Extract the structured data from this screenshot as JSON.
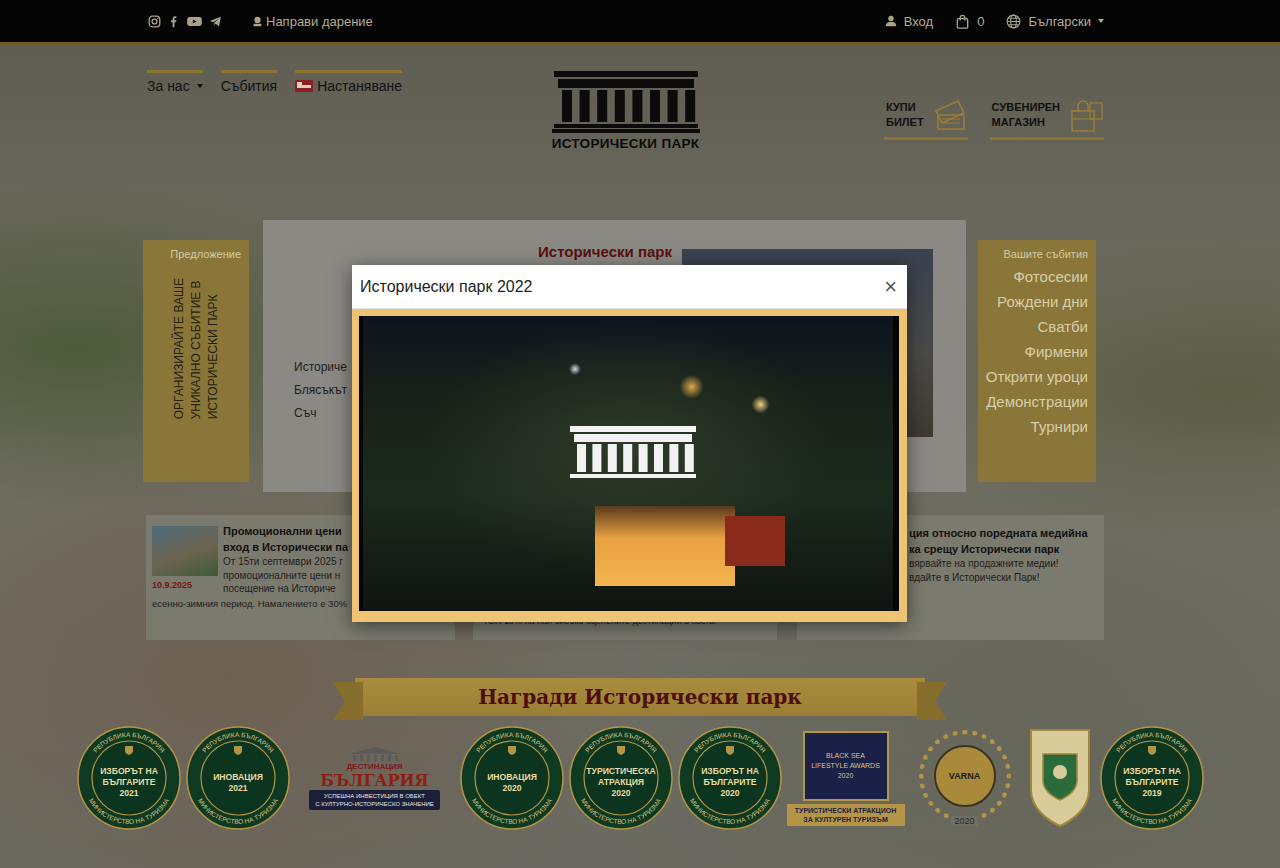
{
  "topbar": {
    "donate": "Направи дарение",
    "login": "Вход",
    "cart_count": "0",
    "language": {
      "label": "Български",
      "dropdown": true
    }
  },
  "nav": [
    {
      "label": "За нас",
      "dropdown": true
    },
    {
      "label": "Събития",
      "dropdown": false
    },
    {
      "label": "Настаняване",
      "dropdown": false
    }
  ],
  "logo": "ИСТОРИЧЕСКИ ПАРК",
  "actions": [
    {
      "lines": [
        "КУПИ",
        "БИЛЕТ"
      ]
    },
    {
      "lines": [
        "СУВЕНИРЕН",
        "МАГАЗИН"
      ]
    }
  ],
  "offer": {
    "label": "Предложение",
    "lines": [
      "ОРГАНИЗИРАЙТЕ ВАШЕ",
      "УНИКАЛНО СЪБИТИЕ В",
      "ИСТОРИЧЕСКИ ПАРК"
    ]
  },
  "feature": {
    "title": "Исторически парк",
    "lines": [
      "Историче",
      "Блясъкът",
      "Съч"
    ]
  },
  "events": {
    "label": "Вашите събития",
    "items": [
      "Фотосесии",
      "Рождени дни",
      "Сватби",
      "Фирмени",
      "Открити уроци",
      "Демонстрации",
      "Турнири"
    ]
  },
  "news_left": {
    "title_lines": [
      "Промоционални цени",
      "вход в Исторически па"
    ],
    "date": "10.9.2025",
    "body_lines": [
      "От 15ти септември 2025 г",
      "промоционалните цени н",
      "посещение на Историче"
    ],
    "tail": "есенно-зимния период. Намалението е 30%"
  },
  "news_middle": {
    "body_lines": [
      "ТОП 10% на най-високо оценените дестинации в света."
    ]
  },
  "news_right": {
    "title_lines": [
      "ция относно поредната медийна",
      "ка срещу Исторически парк"
    ],
    "body_lines": [
      "вярвайте на продажните медии!",
      "вдайте в Исторически Парк!"
    ]
  },
  "awards": {
    "title": "Награди Исторически парк",
    "badges": [
      {
        "kind": "green",
        "top": "РЕПУБЛИКА БЪЛГАРИЯ",
        "lines": [
          "ИЗБОРЪТ НА",
          "БЪЛГАРИТЕ",
          "2021"
        ],
        "bottom": "МИНИСТЕРСТВО НА ТУРИЗМА"
      },
      {
        "kind": "green",
        "top": "РЕПУБЛИКА БЪЛГАРИЯ",
        "lines": [
          "ИНОВАЦИЯ",
          "2021"
        ],
        "bottom": "МИНИСТЕРСТВО НА ТУРИЗМА"
      },
      {
        "kind": "destination",
        "lines": [
          "ДЕСТИНАЦИЯ",
          "БЪЛГАРИЯ"
        ],
        "ribbon": [
          "УСПЕШНА ИНВЕСТИЦИЯ В ОБЕКТ",
          "С КУЛТУРНО-ИСТОРИЧЕСКО ЗНАЧЕНИЕ"
        ]
      },
      {
        "kind": "green",
        "top": "РЕПУБЛИКА БЪЛГАРИЯ",
        "lines": [
          "ИНОВАЦИЯ",
          "2020"
        ],
        "bottom": "МИНИСТЕРСТВО НА ТУРИЗМА"
      },
      {
        "kind": "green",
        "top": "РЕПУБЛИКА БЪЛГАРИЯ",
        "lines": [
          "ТУРИСТИЧЕСКА",
          "АТРАКЦИЯ",
          "2020"
        ],
        "bottom": "МИНИСТЕРСТВО НА ТУРИЗМА"
      },
      {
        "kind": "green",
        "top": "РЕПУБЛИКА БЪЛГАРИЯ",
        "lines": [
          "ИЗБОРЪТ НА",
          "БЪЛГАРИТЕ",
          "2020"
        ],
        "bottom": "МИНИСТЕРСТВО НА ТУРИЗМА"
      },
      {
        "kind": "lifestyle",
        "lines": [
          "BLACK SEA",
          "LIFESTYLE AWARDS",
          "2020"
        ],
        "ribbon": [
          "ТУРИСТИЧЕСКИ АТРАКЦИОН",
          "ЗА КУЛТУРЕН ТУРИЗЪМ"
        ]
      },
      {
        "kind": "varna",
        "lines": [
          "VARNA",
          "2020"
        ]
      },
      {
        "kind": "crest",
        "lines": []
      },
      {
        "kind": "green",
        "top": "РЕПУБЛИКА БЪЛГАРИЯ",
        "lines": [
          "ИЗБОРЪТ НА",
          "БЪЛГАРИТЕ",
          "2019"
        ],
        "bottom": "МИНИСТЕРСТВО НА ТУРИЗМА"
      }
    ]
  },
  "modal": {
    "title": "Исторически парк 2022",
    "close": "×"
  }
}
